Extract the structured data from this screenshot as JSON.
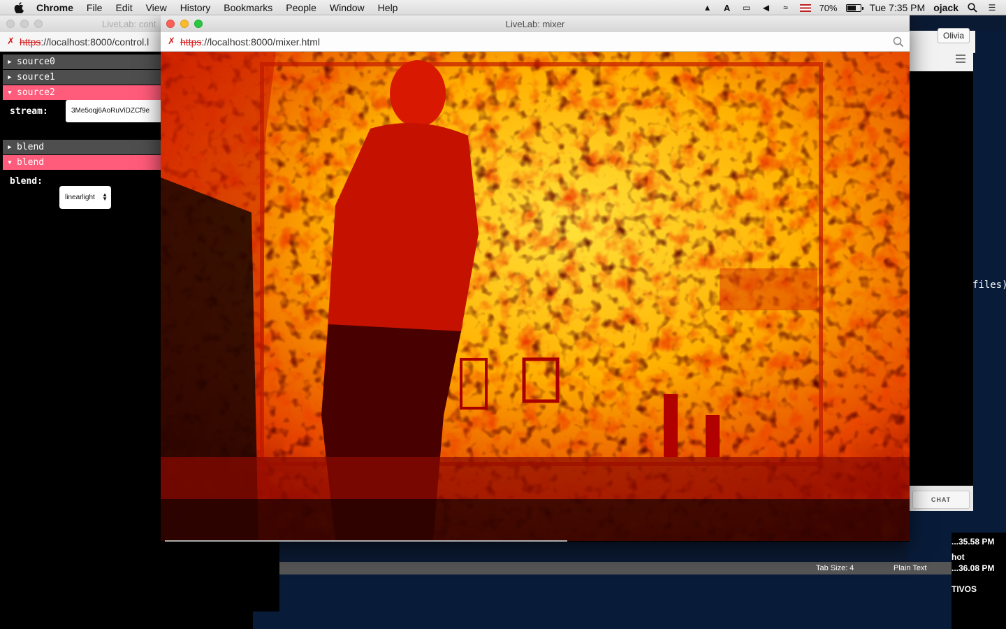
{
  "menubar": {
    "app": "Chrome",
    "items": [
      "File",
      "Edit",
      "View",
      "History",
      "Bookmarks",
      "People",
      "Window",
      "Help"
    ],
    "battery": "70%",
    "battery_level": 0.7,
    "clock": "Tue 7:35 PM",
    "user": "ojack"
  },
  "control_window": {
    "title": "LiveLab: cont",
    "url_scheme": "https",
    "url_rest": "://localhost:8000/control.l",
    "panel": {
      "source0": "source0",
      "source1": "source1",
      "source2": "source2",
      "stream_label": "stream:",
      "stream_value": "3Me5oqj6AoRuViDZCf9e",
      "blend_closed": "blend",
      "blend_open": "blend",
      "blend_label": "blend:",
      "blend_value": "linearlight"
    }
  },
  "mixer_window": {
    "title": "LiveLab: mixer",
    "url_scheme": "https",
    "url_rest": "://localhost:8000/mixer.html"
  },
  "background": {
    "profile_button": "Olivia",
    "terminal_text": "files)",
    "chat_button": "CHAT",
    "tab_size": "Tab Size: 4",
    "syntax": "Plain Text",
    "downloads": [
      "...35.58 PM",
      "hot",
      "...36.08 PM",
      "TIVOS"
    ]
  },
  "colors": {
    "accent_open_folder": "#ff5b7a",
    "closed_folder": "#4e4e4e",
    "insecure_red": "#d21a1a"
  }
}
